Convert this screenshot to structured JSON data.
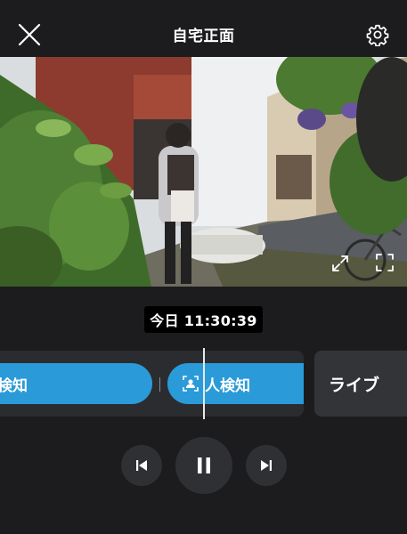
{
  "header": {
    "title": "自宅正面",
    "close_icon": "close-icon",
    "settings_icon": "gear-icon"
  },
  "video": {
    "expand_icon": "expand-arrows-icon",
    "fullscreen_icon": "fullscreen-icon"
  },
  "timestamp": "今日 11:30:39",
  "timeline": {
    "events": [
      {
        "label": "人検知",
        "icon": "none"
      },
      {
        "label": "人検知",
        "icon": "person-icon"
      }
    ],
    "live_label": "ライブ"
  },
  "controls": {
    "prev_icon": "skip-previous-icon",
    "pause_icon": "pause-icon",
    "next_icon": "skip-next-icon"
  },
  "colors": {
    "background": "#1c1c1e",
    "accent": "#2a9bd8"
  }
}
